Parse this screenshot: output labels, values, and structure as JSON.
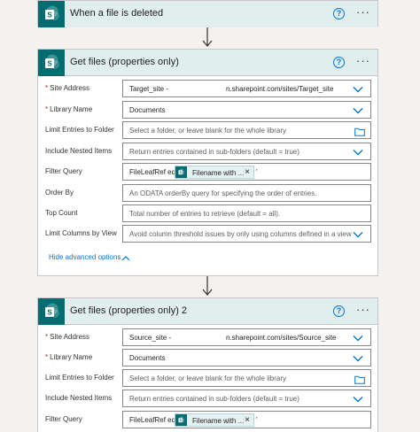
{
  "colors": {
    "accent": "#0078d4",
    "sharepoint": "#036c70",
    "header_bg": "#e1eeee"
  },
  "trigger": {
    "title": "When a file is deleted"
  },
  "step1": {
    "title": "Get files (properties only)",
    "site_address": {
      "label": "Site Address",
      "value": "Target_site -",
      "value_tail": "n.sharepoint.com/sites/Target_site"
    },
    "library_name": {
      "label": "Library Name",
      "value": "Documents"
    },
    "limit_entries": {
      "label": "Limit Entries to Folder",
      "placeholder": "Select a folder, or leave blank for the whole library"
    },
    "include_nested": {
      "label": "Include Nested Items",
      "placeholder": "Return entries contained in sub-folders (default = true)"
    },
    "filter_query": {
      "label": "Filter Query",
      "prefix": "FileLeafRef eq '",
      "token": "Filename with ...",
      "suffix": "'"
    },
    "order_by": {
      "label": "Order By",
      "placeholder": "An ODATA orderBy query for specifying the order of entries."
    },
    "top_count": {
      "label": "Top Count",
      "placeholder": "Total number of entries to retrieve (default = all)."
    },
    "limit_columns": {
      "label": "Limit Columns by View",
      "placeholder": "Avoid column threshold issues by only using columns defined in a view"
    },
    "advanced_link": "Hide advanced options"
  },
  "step2": {
    "title": "Get files (properties only) 2",
    "site_address": {
      "label": "Site Address",
      "value": "Source_site -",
      "value_tail": "n.sharepoint.com/sites/Source_site"
    },
    "library_name": {
      "label": "Library Name",
      "value": "Documents"
    },
    "limit_entries": {
      "label": "Limit Entries to Folder",
      "placeholder": "Select a folder, or leave blank for the whole library"
    },
    "include_nested": {
      "label": "Include Nested Items",
      "placeholder": "Return entries contained in sub-folders (default = true)"
    },
    "filter_query": {
      "label": "Filter Query",
      "prefix": "FileLeafRef eq '",
      "token": "Filename with ...",
      "suffix": "'"
    }
  },
  "icons": {
    "help": "?",
    "more": "···",
    "close": "×"
  }
}
